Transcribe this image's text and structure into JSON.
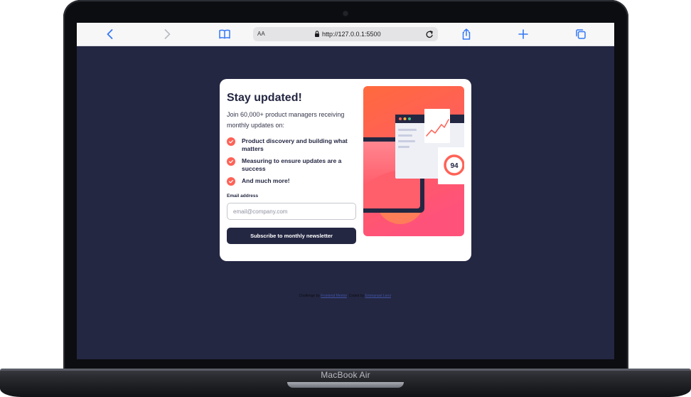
{
  "device": {
    "model_label": "MacBook Air"
  },
  "browser": {
    "text_size_label": "AA",
    "url": "http://127.0.0.1:5500",
    "icons": {
      "back": "chevron-left-icon",
      "forward": "chevron-right-icon",
      "bookmarks": "book-icon",
      "reload": "reload-icon",
      "share": "share-icon",
      "new_tab": "plus-icon",
      "tabs": "tabs-icon"
    },
    "accent_color": "#3478f6"
  },
  "page": {
    "background_color": "#242742",
    "card": {
      "title": "Stay updated!",
      "intro": "Join 60,000+ product managers receiving monthly updates on:",
      "features": [
        "Product discovery and building what matters",
        "Measuring to ensure updates are a success",
        "And much more!"
      ],
      "email_label": "Email address",
      "email_placeholder": "email@company.com",
      "email_value": "",
      "subscribe_label": "Subscribe to monthly newsletter",
      "accent_color": "#ff6257",
      "illustration": {
        "score": "94"
      }
    },
    "attribution": {
      "prefix": "Challenge by",
      "challenge_link": "Frontend Mentor",
      "middle": ". Coded by",
      "author_link": "Emmanuel Leroi",
      "suffix": "."
    }
  }
}
